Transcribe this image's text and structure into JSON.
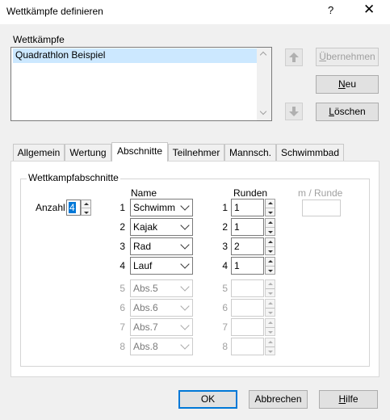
{
  "window": {
    "title": "Wettkämpfe definieren",
    "help": "?",
    "close": "✕"
  },
  "list": {
    "label": "Wettkämpfe",
    "items": [
      "Quadrathlon Beispiel"
    ]
  },
  "buttons": {
    "uebernehmen": "Übernehmen",
    "neu": "Neu",
    "loeschen": "Löschen",
    "ok": "OK",
    "abbrechen": "Abbrechen",
    "hilfe": "Hilfe"
  },
  "tabs": [
    "Allgemein",
    "Wertung",
    "Abschnitte",
    "Teilnehmer",
    "Mannsch.",
    "Schwimmbad"
  ],
  "active_tab": "Abschnitte",
  "section": {
    "group_label": "Wettkampfabschnitte",
    "anzahl_label": "Anzahl",
    "anzahl_value": "4",
    "col_name": "Name",
    "col_runden": "Runden",
    "col_m_runde": "m / Runde",
    "m_runde_value": "",
    "rows": [
      {
        "num": "1",
        "name": "Schwimm",
        "runden": "1",
        "enabled": true
      },
      {
        "num": "2",
        "name": "Kajak",
        "runden": "1",
        "enabled": true
      },
      {
        "num": "3",
        "name": "Rad",
        "runden": "2",
        "enabled": true
      },
      {
        "num": "4",
        "name": "Lauf",
        "runden": "1",
        "enabled": true
      },
      {
        "num": "5",
        "name": "Abs.5",
        "runden": "",
        "enabled": false
      },
      {
        "num": "6",
        "name": "Abs.6",
        "runden": "",
        "enabled": false
      },
      {
        "num": "7",
        "name": "Abs.7",
        "runden": "",
        "enabled": false
      },
      {
        "num": "8",
        "name": "Abs.8",
        "runden": "",
        "enabled": false
      }
    ]
  },
  "colors": {
    "accent": "#0078d7",
    "selection": "#cce8ff"
  }
}
